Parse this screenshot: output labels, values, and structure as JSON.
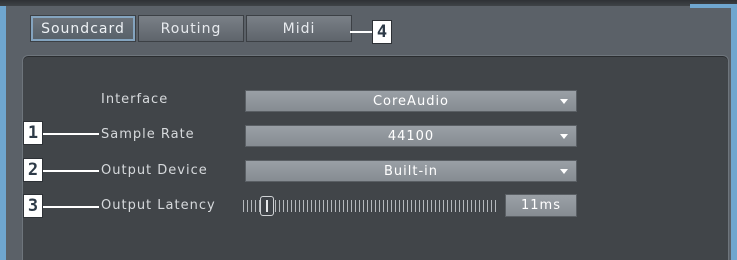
{
  "tabs": [
    {
      "label": "Soundcard",
      "active": true
    },
    {
      "label": "Routing",
      "active": false
    },
    {
      "label": "Midi",
      "active": false
    }
  ],
  "settings": {
    "interface": {
      "label": "Interface",
      "value": "CoreAudio"
    },
    "sample_rate": {
      "label": "Sample Rate",
      "value": "44100"
    },
    "output_device": {
      "label": "Output Device",
      "value": "Built-in"
    },
    "output_latency": {
      "label": "Output Latency",
      "value": "11ms",
      "slider_position": 0.07
    }
  },
  "callouts": [
    "1",
    "2",
    "3",
    "4"
  ],
  "colors": {
    "frame": "#6fa6cf",
    "panel": "#414549",
    "dropdown": "#8f959b"
  }
}
